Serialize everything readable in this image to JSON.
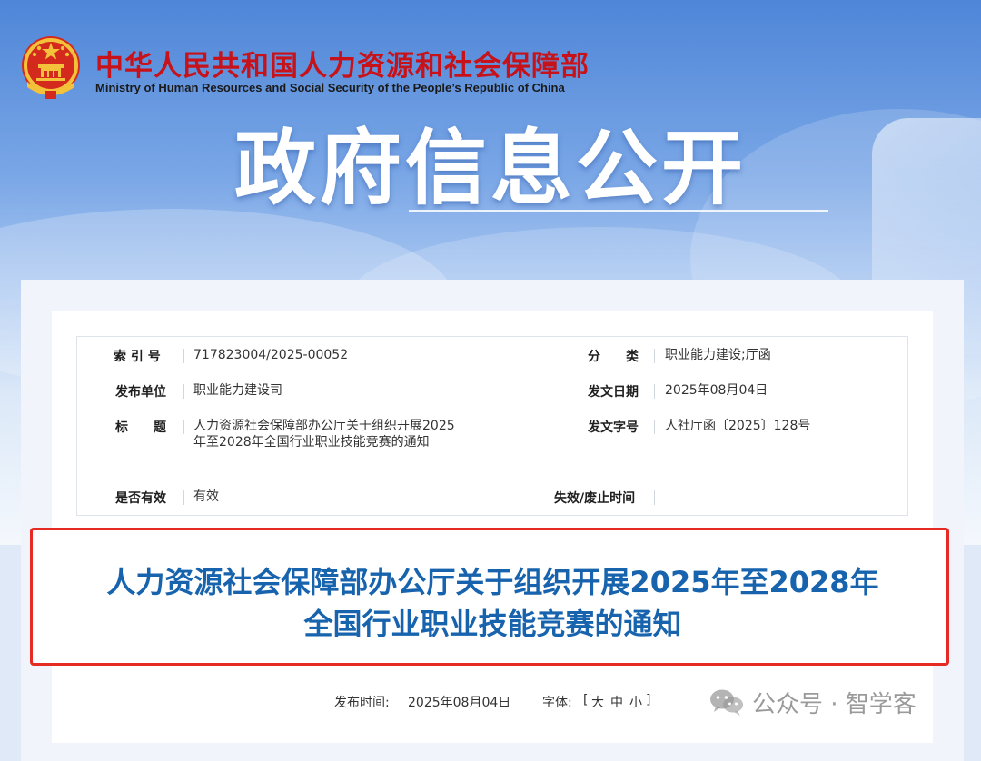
{
  "header": {
    "ministry_name_cn": "中华人民共和国人力资源和社会保障部",
    "ministry_name_en": "Ministry of Human Resources and Social Security of the People’s Republic of China",
    "banner_title": "政府信息公开"
  },
  "meta": {
    "index_label": "索 引 号",
    "index_value": "717823004/2025-00052",
    "category_label": "分　　类",
    "category_value": "职业能力建设;厅函",
    "publisher_label": "发布单位",
    "publisher_value": "职业能力建设司",
    "issue_date_label": "发文日期",
    "issue_date_value": "2025年08月04日",
    "title_label": "标　　题",
    "title_value": "人力资源社会保障部办公厅关于组织开展2025年至2028年全国行业职业技能竞赛的通知",
    "doc_number_label": "发文字号",
    "doc_number_value": "人社厅函〔2025〕128号",
    "valid_label": "是否有效",
    "valid_value": "有效",
    "expiry_label": "失效/废止时间",
    "expiry_value": ""
  },
  "notice": {
    "title_line1": "人力资源社会保障部办公厅关于组织开展2025年至2028年",
    "title_line2": "全国行业职业技能竞赛的通知"
  },
  "publish": {
    "time_label": "发布时间:",
    "time_value": "2025年08月04日",
    "font_label": "字体:",
    "bracket_open": "[",
    "size_large": "大",
    "size_medium": "中",
    "size_small": "小",
    "bracket_close": "]"
  },
  "watermark": {
    "icon": "wechat-icon",
    "text": "公众号 · 智学客"
  },
  "colors": {
    "ministry_red": "#c8121a",
    "notice_blue": "#1763ad",
    "highlight_red": "#e62b24"
  }
}
